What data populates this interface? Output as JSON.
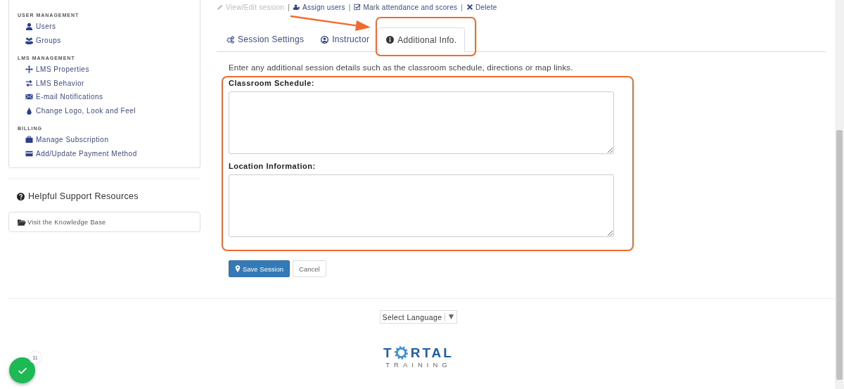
{
  "sidebar": {
    "sections": [
      {
        "heading": "USER MANAGEMENT",
        "items": [
          {
            "kind": "user",
            "label": "Users"
          },
          {
            "kind": "users",
            "label": "Groups"
          }
        ]
      },
      {
        "heading": "LMS MANAGEMENT",
        "items": [
          {
            "kind": "move",
            "label": "LMS Properties"
          },
          {
            "kind": "swap",
            "label": "LMS Behavior"
          },
          {
            "kind": "mail",
            "label": "E-mail Notifications"
          },
          {
            "kind": "drop",
            "label": "Change Logo, Look and Feel"
          }
        ]
      },
      {
        "heading": "BILLING",
        "items": [
          {
            "kind": "briefcase",
            "label": "Manage Subscription"
          },
          {
            "kind": "card",
            "label": "Add/Update Payment Method"
          }
        ]
      }
    ],
    "support_heading": "Helpful Support Resources",
    "support_link": "Visit the Knowledge Base"
  },
  "actions": [
    {
      "kind": "pencil",
      "label": "View/Edit session",
      "disabled": true,
      "separator": "|"
    },
    {
      "kind": "user-plus",
      "label": "Assign users",
      "disabled": false,
      "separator": "|"
    },
    {
      "kind": "check",
      "label": "Mark attendance and scores",
      "disabled": false,
      "separator": "|"
    },
    {
      "kind": "x",
      "label": "Delete",
      "disabled": false
    }
  ],
  "tabs": [
    {
      "kind": "gears",
      "label": "Session Settings",
      "selected": false
    },
    {
      "kind": "person",
      "label": "Instructor",
      "selected": false
    },
    {
      "kind": "info",
      "label": "Additional Info.",
      "selected": true
    }
  ],
  "description": "Enter any additional session details such as the classroom schedule, directions or map links.",
  "fields": [
    {
      "label": "Classroom Schedule:"
    },
    {
      "label": "Location Information:"
    }
  ],
  "buttons": {
    "save": "Save Session",
    "cancel": "Cancel"
  },
  "language_select": "Select Language",
  "logo": {
    "start": "T",
    "end": "RTAL",
    "subtitle": "TRAINING"
  },
  "badge": {
    "count": "11"
  }
}
